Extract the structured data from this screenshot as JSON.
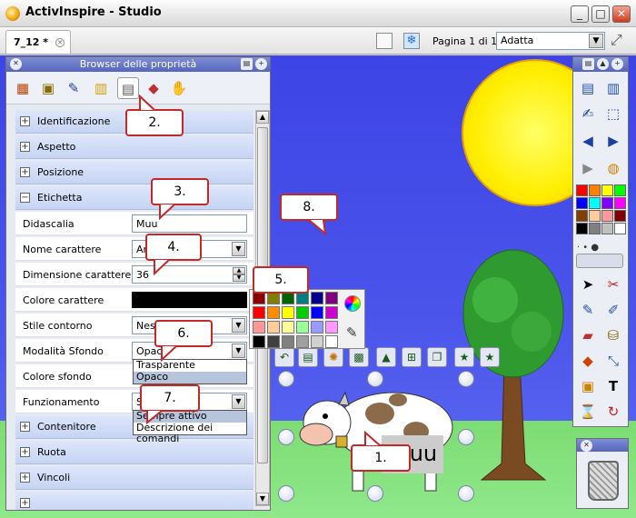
{
  "window": {
    "title": "ActivInspire - Studio"
  },
  "tab": {
    "label": "7_12 *"
  },
  "toolbar": {
    "page_indicator": "Pagina 1 di 1",
    "zoom_value": "Adatta"
  },
  "property_browser": {
    "title": "Browser delle proprietà",
    "sections_top": [
      "Identificazione",
      "Aspetto",
      "Posizione",
      "Etichetta"
    ],
    "properties": [
      {
        "label": "Didascalia",
        "value": "Muu",
        "kind": "text"
      },
      {
        "label": "Nome carattere",
        "value": "Ar",
        "kind": "select"
      },
      {
        "label": "Dimensione carattere",
        "value": "36",
        "kind": "spin"
      },
      {
        "label": "Colore carattere",
        "value": "#000000",
        "kind": "color"
      },
      {
        "label": "Stile contorno",
        "value": "Ness",
        "kind": "select"
      },
      {
        "label": "Modalità Sfondo",
        "value": "Opaco",
        "kind": "select"
      },
      {
        "label": "Colore sfondo",
        "value": "",
        "kind": "none"
      },
      {
        "label": "Funzionamento",
        "value": "Se",
        "kind": "select"
      }
    ],
    "sections_bottom": [
      "Contenitore",
      "Ruota",
      "Vincoli"
    ]
  },
  "background_dropdown": {
    "options": [
      "Trasparente",
      "Opaco"
    ],
    "selected": "Opaco"
  },
  "behavior_dropdown": {
    "options": [
      "Sempre attivo",
      "Descrizione dei comandi"
    ],
    "selected": "Sempre attivo"
  },
  "callouts": [
    "1.",
    "2.",
    "3.",
    "4.",
    "5.",
    "6.",
    "7.",
    "8."
  ],
  "canvas": {
    "label_text": "Muu"
  },
  "palette_colors": [
    "#8b0000",
    "#808000",
    "#006400",
    "#008080",
    "#00008b",
    "#800080",
    "#ff0000",
    "#ff8c00",
    "#ffff00",
    "#00cc00",
    "#0000ff",
    "#cc00cc",
    "#ff9999",
    "#ffcc99",
    "#ffff99",
    "#99ff99",
    "#9999ff",
    "#ff99ff",
    "#000000",
    "#404040",
    "#808080",
    "#a0a0a0",
    "#d0d0d0",
    "#ffffff"
  ],
  "toolbox_colors": [
    "#ff0000",
    "#ff8000",
    "#ffff00",
    "#00ff00",
    "#0000ff",
    "#00ffff",
    "#8000ff",
    "#ff00ff",
    "#804000",
    "#ffcc99",
    "#ff9999",
    "#800000",
    "#000000",
    "#808080",
    "#c0c0c0",
    "#ffffff"
  ]
}
